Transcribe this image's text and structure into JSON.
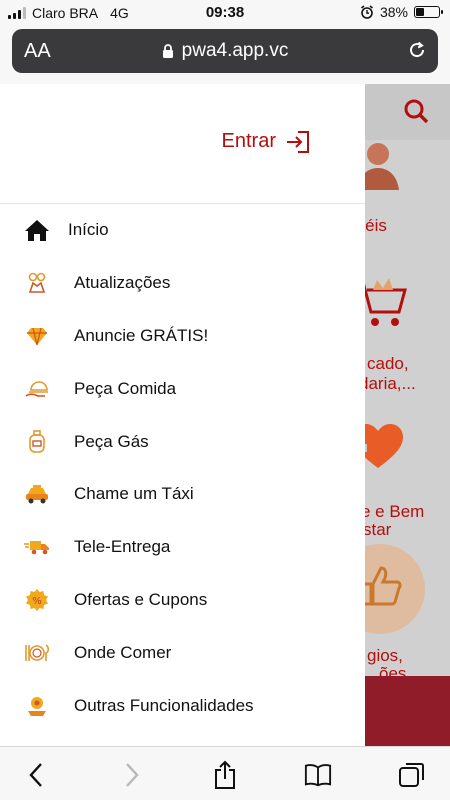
{
  "status_bar": {
    "carrier": "Claro BRA",
    "network": "4G",
    "time": "09:38",
    "battery": "38%",
    "battery_level": 0.38
  },
  "browser": {
    "aa_label": "AA",
    "url": "pwa4.app.vc"
  },
  "drawer": {
    "login_label": "Entrar",
    "items": [
      {
        "label": "Início",
        "icon": "home-icon"
      },
      {
        "label": "Atualizações",
        "icon": "updates-icon"
      },
      {
        "label": "Anuncie GRÁTIS!",
        "icon": "diamond-icon"
      },
      {
        "label": "Peça Comida",
        "icon": "food-delivery-icon"
      },
      {
        "label": "Peça Gás",
        "icon": "gas-cylinder-icon"
      },
      {
        "label": "Chame um Táxi",
        "icon": "taxi-icon"
      },
      {
        "label": "Tele-Entrega",
        "icon": "delivery-truck-icon"
      },
      {
        "label": "Ofertas e Cupons",
        "icon": "discount-badge-icon"
      },
      {
        "label": "Onde Comer",
        "icon": "plate-cutlery-icon"
      },
      {
        "label": "Outras Funcionalidades",
        "icon": "misc-features-icon"
      }
    ]
  },
  "background_page": {
    "labels": [
      "otéis",
      "cado,",
      "daria,...",
      "e e Bem",
      "star",
      "gios,",
      "ões"
    ]
  },
  "colors": {
    "accent": "#b30f0f",
    "orange": "#f0a020",
    "footer": "#8f1c28"
  }
}
